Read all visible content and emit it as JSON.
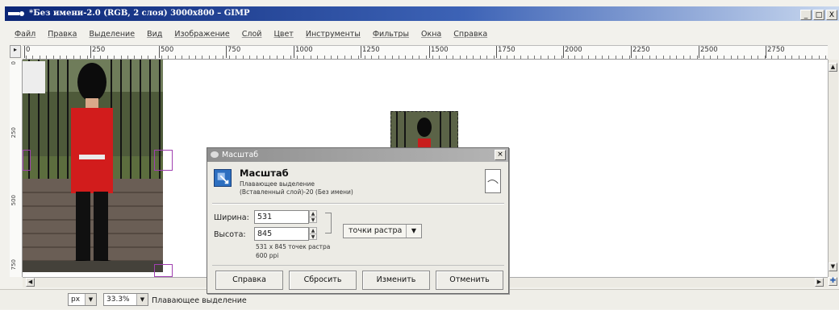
{
  "window": {
    "title": "*Без имени-2.0 (RGB, 2 слоя) 3000x800 – GIMP",
    "buttons": [
      "_",
      "□",
      "X"
    ]
  },
  "menu": [
    "Файл",
    "Правка",
    "Выделение",
    "Вид",
    "Изображение",
    "Слой",
    "Цвет",
    "Инструменты",
    "Фильтры",
    "Окна",
    "Справка"
  ],
  "ruler": {
    "h_ticks": [
      "0",
      "250",
      "500",
      "750",
      "1000",
      "1250",
      "1500",
      "1750",
      "2000",
      "2250",
      "2500",
      "2750"
    ],
    "v_ticks": [
      "0",
      "250",
      "500",
      "750"
    ]
  },
  "statusbar": {
    "unit": "px",
    "zoom": "33.3%",
    "message": "Плавающее выделение"
  },
  "dialog": {
    "window_title": "Масштаб",
    "heading": "Масштаб",
    "subtitle": "Плавающее выделение",
    "layer": "(Вставленный слой)-20 (Без имени)",
    "width_label": "Ширина:",
    "width_value": "531",
    "height_label": "Высота:",
    "height_value": "845",
    "unit": "точки растра",
    "size_info": "531 x 845 точек растра",
    "dpi_info": "600 ppi",
    "buttons": {
      "help": "Справка",
      "reset": "Сбросить",
      "scale": "Изменить",
      "cancel": "Отменить"
    }
  }
}
